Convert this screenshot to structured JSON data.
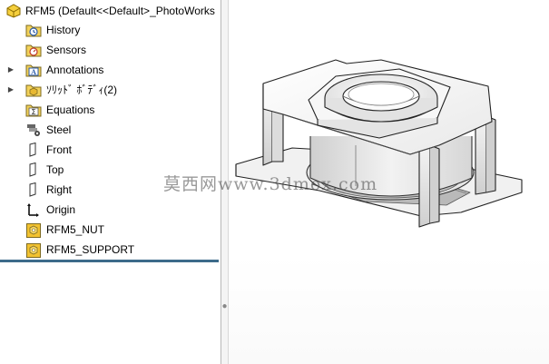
{
  "tree": {
    "root": {
      "label": "RFM5  (Default<<Default>_PhotoWorks",
      "icon": "part-icon"
    },
    "items": [
      {
        "label": "History",
        "icon": "history-folder-icon",
        "expandable": false
      },
      {
        "label": "Sensors",
        "icon": "sensors-folder-icon",
        "expandable": false
      },
      {
        "label": "Annotations",
        "icon": "annotations-icon",
        "expandable": true
      },
      {
        "label": "ｿﾘｯﾄﾞ ﾎﾞﾃﾞｨ(2)",
        "icon": "solid-bodies-icon",
        "expandable": true
      },
      {
        "label": "Equations",
        "icon": "equations-icon",
        "expandable": false
      },
      {
        "label": "Steel",
        "icon": "material-icon",
        "expandable": false
      },
      {
        "label": "Front",
        "icon": "plane-icon",
        "expandable": false
      },
      {
        "label": "Top",
        "icon": "plane-icon",
        "expandable": false
      },
      {
        "label": "Right",
        "icon": "plane-icon",
        "expandable": false
      },
      {
        "label": "Origin",
        "icon": "origin-icon",
        "expandable": false
      },
      {
        "label": "RFM5_NUT",
        "icon": "feature-icon",
        "expandable": false
      },
      {
        "label": "RFM5_SUPPORT",
        "icon": "feature-icon",
        "expandable": false
      }
    ]
  },
  "viewport": {
    "watermark": "莫西网www.3dmox.com"
  },
  "colors": {
    "folder_yellow": "#f3d25a",
    "feature_yellow": "#f2c230",
    "tree_end_line": "#3d6b8a"
  }
}
